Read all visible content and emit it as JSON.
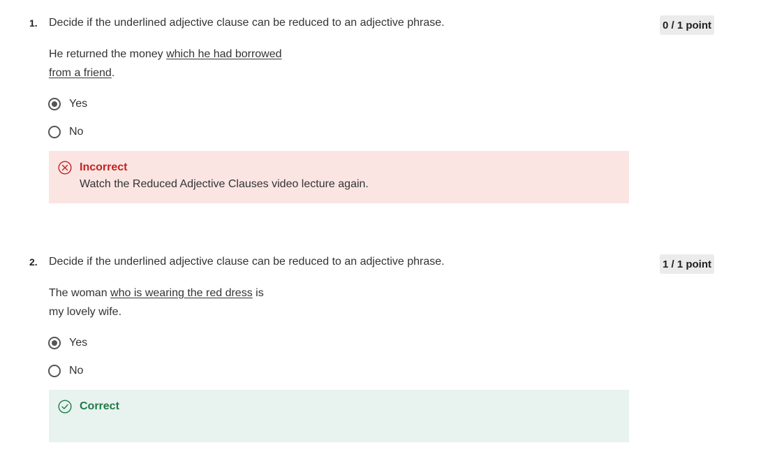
{
  "questions": [
    {
      "number": "1.",
      "prompt": "Decide if the underlined adjective clause can be reduced to an adjective phrase.",
      "score": "0 / 1 point",
      "sentence": {
        "before": "He returned the money ",
        "underlined_line1": "which he had borrowed",
        "underlined_line2": "from a friend",
        "after": "."
      },
      "options": [
        {
          "label": "Yes",
          "selected": true
        },
        {
          "label": "No",
          "selected": false
        }
      ],
      "feedback": {
        "status": "incorrect",
        "title": "Incorrect",
        "text": "Watch the Reduced Adjective Clauses video lecture again."
      }
    },
    {
      "number": "2.",
      "prompt": "Decide if the underlined adjective clause can be reduced to an adjective phrase.",
      "score": "1 / 1 point",
      "sentence": {
        "before": "The woman ",
        "underlined": "who is wearing the red dress",
        "after_line1": " is",
        "line2": "my lovely wife."
      },
      "options": [
        {
          "label": "Yes",
          "selected": true
        },
        {
          "label": "No",
          "selected": false
        }
      ],
      "feedback": {
        "status": "correct",
        "title": "Correct",
        "text": ""
      }
    }
  ],
  "colors": {
    "incorrect_bg": "#fae5e3",
    "incorrect_accent": "#c4221f",
    "correct_bg": "#e8f2ee",
    "correct_accent": "#1f7a4a",
    "badge_bg": "#ebebeb"
  },
  "icons": {
    "incorrect": "x-circle-icon",
    "correct": "check-circle-icon"
  }
}
